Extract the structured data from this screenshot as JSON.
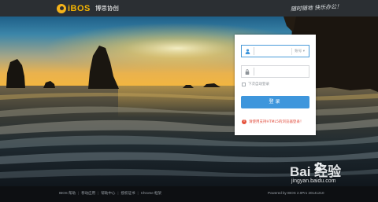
{
  "header": {
    "logo_text": "iBOS",
    "brand_cn": "博思协创",
    "slogan": "随时随地 快乐办公！"
  },
  "login": {
    "username_value": "",
    "account_type": "账号 ▾",
    "password_value": "",
    "remember_label": "下次自动登录",
    "submit_label": "登录",
    "notice_icon": "!",
    "notice_text": "请使用支持HTML5的浏览器登录！"
  },
  "footer": {
    "links": [
      "IBOS 帮助",
      "移动应用",
      "帮助中心",
      "授权证书",
      "Chrome 框架"
    ],
    "powered": "Powered by IBOS 2.0Pro 20141210"
  },
  "watermark": {
    "main": "Bai 经验",
    "url": "jingyan.baidu.com"
  },
  "colors": {
    "accent": "#3e96dc",
    "logo": "#f5b31a",
    "notice": "#e14b3b",
    "topbar": "#2b2f33"
  },
  "icons": [
    "user-icon",
    "lock-icon",
    "warning-icon",
    "paw-icon"
  ]
}
